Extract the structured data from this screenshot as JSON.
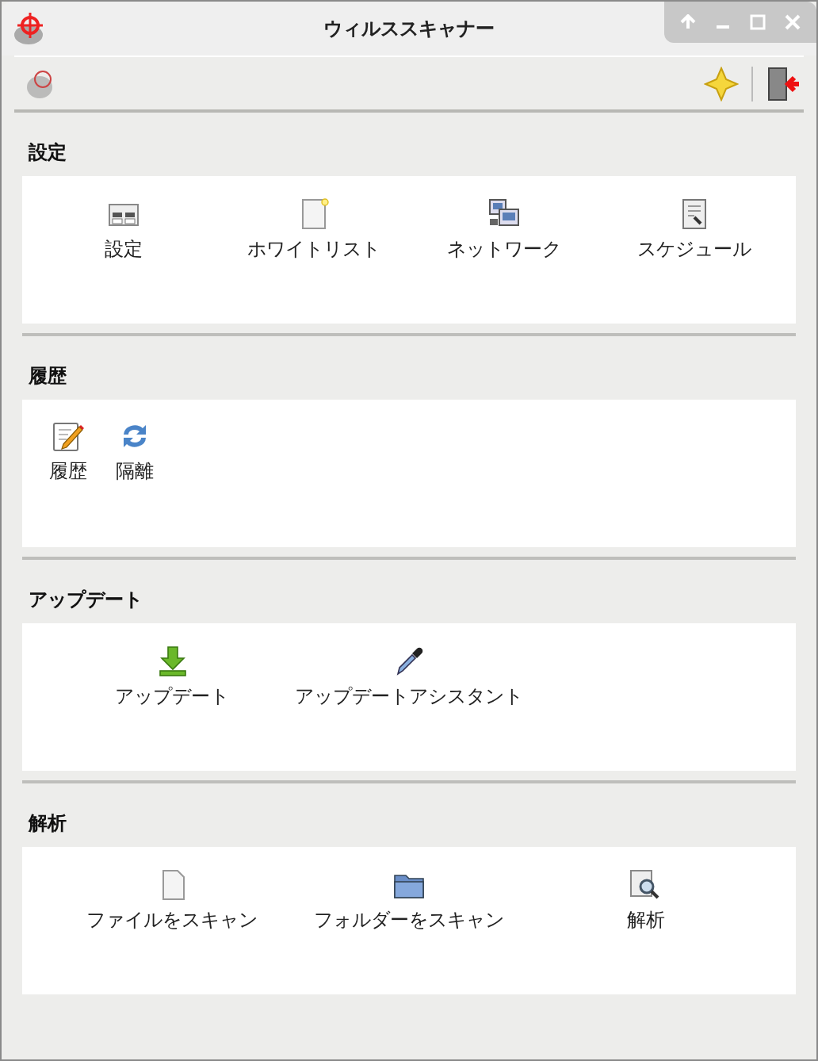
{
  "window": {
    "title": "ウィルススキャナー"
  },
  "sections": [
    {
      "title": "設定",
      "items": [
        {
          "label": "設定",
          "kind": "settings"
        },
        {
          "label": "ホワイトリスト",
          "kind": "note"
        },
        {
          "label": "ネットワーク",
          "kind": "network"
        },
        {
          "label": "スケジュール",
          "kind": "schedule"
        }
      ]
    },
    {
      "title": "履歴",
      "items": [
        {
          "label": "履歴",
          "kind": "pencil"
        },
        {
          "label": "隔離",
          "kind": "refresh"
        }
      ]
    },
    {
      "title": "アップデート",
      "items": [
        {
          "label": "アップデート",
          "kind": "download"
        },
        {
          "label": "アップデートアシスタント",
          "kind": "dropper"
        }
      ]
    },
    {
      "title": "解析",
      "items": [
        {
          "label": "ファイルをスキャン",
          "kind": "file"
        },
        {
          "label": "フォルダーをスキャン",
          "kind": "folder"
        },
        {
          "label": "解析",
          "kind": "search"
        }
      ]
    }
  ]
}
